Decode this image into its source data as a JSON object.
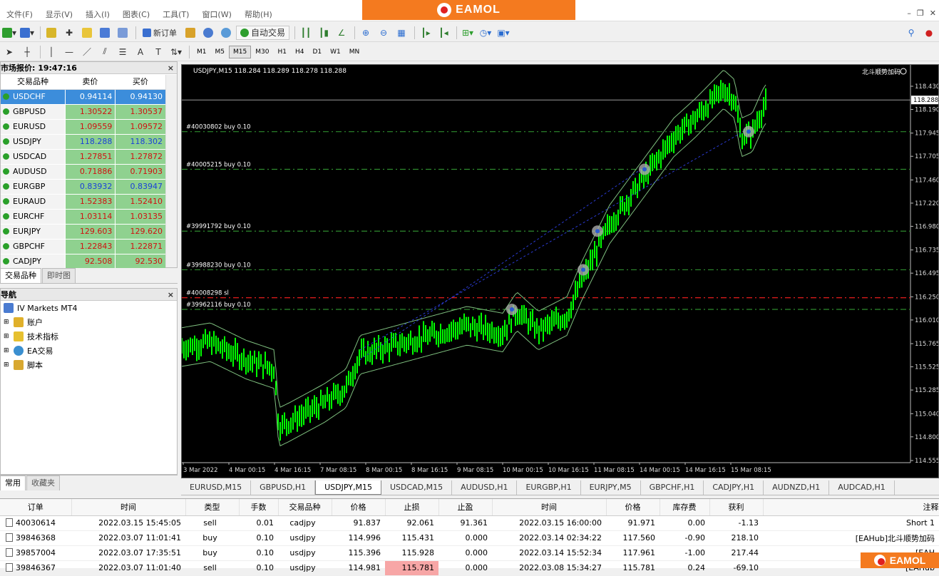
{
  "menu": [
    "文件(F)",
    "显示(V)",
    "插入(I)",
    "图表(C)",
    "工具(T)",
    "窗口(W)",
    "帮助(H)"
  ],
  "brand": "EAMOL",
  "toolbar": {
    "new_order": "新订单",
    "autotrade": "自动交易"
  },
  "timeframes": [
    "M1",
    "M5",
    "M15",
    "M30",
    "H1",
    "H4",
    "D1",
    "W1",
    "MN"
  ],
  "active_timeframe": "M15",
  "market_watch": {
    "title": "市场报价: 19:47:16",
    "headers": [
      "交易品种",
      "卖价",
      "买价"
    ],
    "rows": [
      {
        "symbol": "USDCHF",
        "bid": "0.94114",
        "ask": "0.94130",
        "dir": "up",
        "selected": true
      },
      {
        "symbol": "GBPUSD",
        "bid": "1.30522",
        "ask": "1.30537",
        "dir": "dn"
      },
      {
        "symbol": "EURUSD",
        "bid": "1.09559",
        "ask": "1.09572",
        "dir": "dn"
      },
      {
        "symbol": "USDJPY",
        "bid": "118.288",
        "ask": "118.302",
        "dir": "up"
      },
      {
        "symbol": "USDCAD",
        "bid": "1.27851",
        "ask": "1.27872",
        "dir": "dn"
      },
      {
        "symbol": "AUDUSD",
        "bid": "0.71886",
        "ask": "0.71903",
        "dir": "dn"
      },
      {
        "symbol": "EURGBP",
        "bid": "0.83932",
        "ask": "0.83947",
        "dir": "up"
      },
      {
        "symbol": "EURAUD",
        "bid": "1.52383",
        "ask": "1.52410",
        "dir": "dn"
      },
      {
        "symbol": "EURCHF",
        "bid": "1.03114",
        "ask": "1.03135",
        "dir": "dn"
      },
      {
        "symbol": "EURJPY",
        "bid": "129.603",
        "ask": "129.620",
        "dir": "dn"
      },
      {
        "symbol": "GBPCHF",
        "bid": "1.22843",
        "ask": "1.22871",
        "dir": "dn"
      },
      {
        "symbol": "CADJPY",
        "bid": "92.508",
        "ask": "92.530",
        "dir": "dn"
      }
    ],
    "tabs": [
      "交易品种",
      "即时图"
    ]
  },
  "navigator": {
    "title": "导航",
    "root": "IV Markets MT4",
    "items": [
      "账户",
      "技术指标",
      "EA交易",
      "脚本"
    ],
    "tabs": [
      "常用",
      "收藏夹"
    ]
  },
  "chart": {
    "header": "USDJPY,M15  118.284 118.289 118.278 118.288",
    "ea_label": "北斗顺势加码",
    "current_price": "118.288",
    "y_ticks": [
      "118.430",
      "118.190",
      "117.945",
      "117.705",
      "117.460",
      "117.220",
      "116.980",
      "116.735",
      "116.495",
      "116.250",
      "116.010",
      "115.765",
      "115.525",
      "115.285",
      "115.040",
      "114.800",
      "114.555"
    ],
    "x_ticks": [
      "3 Mar 2022",
      "4 Mar 00:15",
      "4 Mar 16:15",
      "7 Mar 08:15",
      "8 Mar 00:15",
      "8 Mar 16:15",
      "9 Mar 08:15",
      "10 Mar 00:15",
      "10 Mar 16:15",
      "11 Mar 08:15",
      "14 Mar 00:15",
      "14 Mar 16:15",
      "15 Mar 08:15"
    ],
    "order_lines": [
      {
        "label": "#40030802 buy 0.10",
        "price": 117.96
      },
      {
        "label": "#40005215 buy 0.10",
        "price": 117.57
      },
      {
        "label": "#39991792 buy 0.10",
        "price": 116.93
      },
      {
        "label": "#39988230 buy 0.10",
        "price": 116.53
      },
      {
        "label": "#39962116 buy 0.10",
        "price": 116.12
      }
    ],
    "sl_label": "#40008298 sl",
    "sl_price": 116.24,
    "tabs": [
      "EURUSD,M15",
      "GBPUSD,H1",
      "USDJPY,M15",
      "USDCAD,M15",
      "AUDUSD,H1",
      "EURGBP,H1",
      "EURJPY,M5",
      "GBPCHF,H1",
      "CADJPY,H1",
      "AUDNZD,H1",
      "AUDCAD,H1"
    ],
    "active_tab": "USDJPY,M15"
  },
  "terminal": {
    "headers": [
      "订单",
      "时间",
      "类型",
      "手数",
      "交易品种",
      "价格",
      "止损",
      "止盈",
      "时间",
      "价格",
      "库存费",
      "获利",
      "注释"
    ],
    "rows": [
      [
        "40030614",
        "2022.03.15 15:45:05",
        "sell",
        "0.01",
        "cadjpy",
        "91.837",
        "92.061",
        "91.361",
        "2022.03.15 16:00:00",
        "91.971",
        "0.00",
        "-1.13",
        "Short 1"
      ],
      [
        "39846368",
        "2022.03.07 11:01:41",
        "buy",
        "0.10",
        "usdjpy",
        "114.996",
        "115.431",
        "0.000",
        "2022.03.14 02:34:22",
        "117.560",
        "-0.90",
        "218.10",
        "[EAHub]北斗顺势加码"
      ],
      [
        "39857004",
        "2022.03.07 17:35:51",
        "buy",
        "0.10",
        "usdjpy",
        "115.396",
        "115.928",
        "0.000",
        "2022.03.14 15:52:34",
        "117.961",
        "-1.00",
        "217.44",
        "[EAH"
      ],
      [
        "39846367",
        "2022.03.07 11:01:40",
        "sell",
        "0.10",
        "usdjpy",
        "114.981",
        "115.781",
        "0.000",
        "2022.03.08 15:34:27",
        "115.781",
        "0.24",
        "-69.10",
        "[EAHub"
      ]
    ]
  },
  "colors": {
    "accent": "#f47a1f",
    "candle": "#00ff00",
    "grid_line": "#2e8b2e",
    "sl_line": "#ff2020"
  }
}
